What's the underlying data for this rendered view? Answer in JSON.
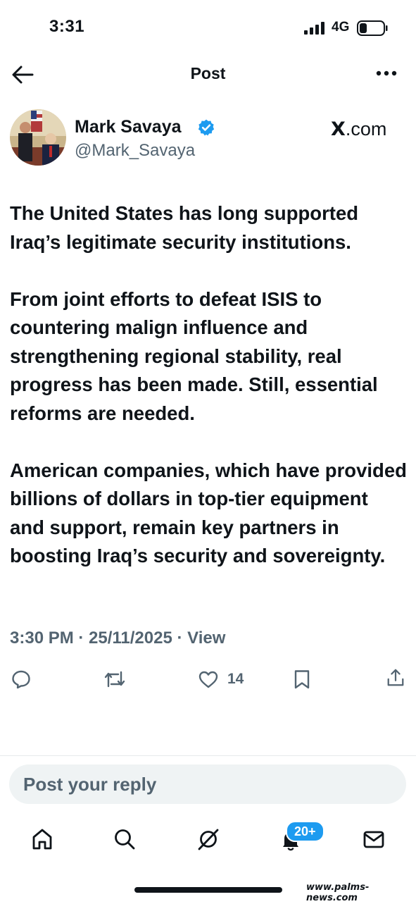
{
  "status_bar": {
    "time": "3:31",
    "network": "4G"
  },
  "header": {
    "title": "Post"
  },
  "author": {
    "name": "Mark Savaya",
    "handle": "@Mark_Savaya"
  },
  "source": {
    "site_suffix": ".com",
    "logo_text": "X"
  },
  "post": {
    "paragraphs": [
      "The United States has long supported Iraq’s legitimate security institutions.",
      "From joint efforts to defeat ISIS to countering malign influence and strengthening regional stability, real progress has been made. Still, essential reforms are needed.",
      "American companies, which have provided billions of dollars in top-tier equipment and support, remain key partners in boosting Iraq’s security and sovereignty."
    ],
    "timestamp": "3:30 PM · 25/11/2025 · View"
  },
  "actions": {
    "like_count": "14"
  },
  "reply": {
    "placeholder": "Post your reply"
  },
  "nav": {
    "notification_badge": "20+"
  },
  "watermark": "www.palms-news.com",
  "colors": {
    "accent": "#1d9bf0",
    "text": "#0f1419",
    "muted": "#536471"
  }
}
